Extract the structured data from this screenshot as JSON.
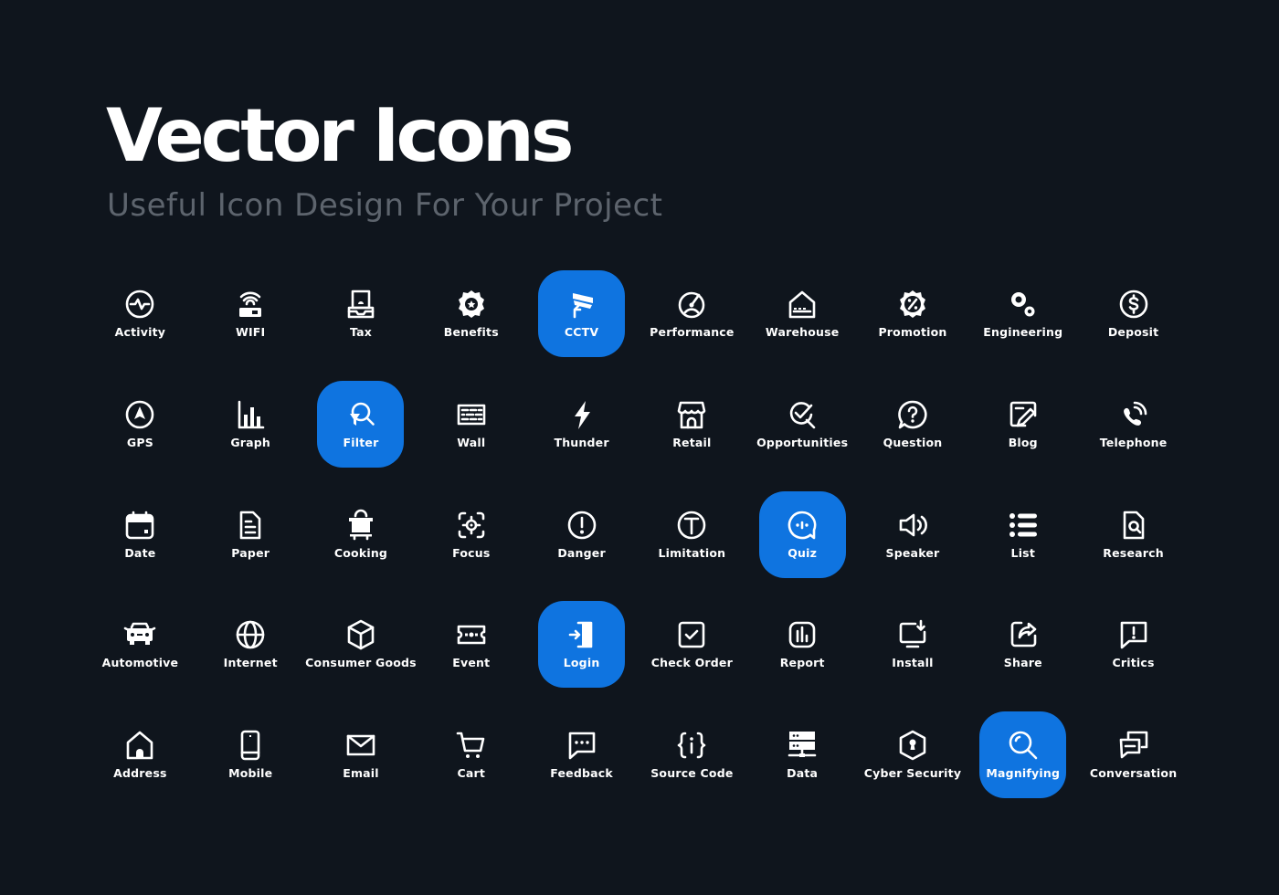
{
  "header": {
    "title": "Vector Icons",
    "subtitle": "Useful Icon Design For Your Project"
  },
  "colors": {
    "background": "#0f151d",
    "accent": "#0f74e0",
    "title": "#ffffff",
    "subtitle": "#5d646d",
    "icon": "#ffffff"
  },
  "icons": [
    {
      "label": "Activity",
      "icon": "activity-icon",
      "selected": false
    },
    {
      "label": "WIFI",
      "icon": "wifi-router-icon",
      "selected": false
    },
    {
      "label": "Tax",
      "icon": "tax-icon",
      "selected": false
    },
    {
      "label": "Benefits",
      "icon": "benefits-badge-icon",
      "selected": false
    },
    {
      "label": "CCTV",
      "icon": "cctv-camera-icon",
      "selected": true
    },
    {
      "label": "Performance",
      "icon": "performance-gauge-icon",
      "selected": false
    },
    {
      "label": "Warehouse",
      "icon": "warehouse-icon",
      "selected": false
    },
    {
      "label": "Promotion",
      "icon": "promotion-percent-badge-icon",
      "selected": false
    },
    {
      "label": "Engineering",
      "icon": "engineering-gears-icon",
      "selected": false
    },
    {
      "label": "Deposit",
      "icon": "deposit-dollar-icon",
      "selected": false
    },
    {
      "label": "GPS",
      "icon": "gps-navigation-icon",
      "selected": false
    },
    {
      "label": "Graph",
      "icon": "bar-graph-icon",
      "selected": false
    },
    {
      "label": "Filter",
      "icon": "filter-search-icon",
      "selected": true
    },
    {
      "label": "Wall",
      "icon": "brick-wall-icon",
      "selected": false
    },
    {
      "label": "Thunder",
      "icon": "thunder-bolt-icon",
      "selected": false
    },
    {
      "label": "Retail",
      "icon": "retail-store-icon",
      "selected": false
    },
    {
      "label": "Opportunities",
      "icon": "opportunities-search-check-icon",
      "selected": false
    },
    {
      "label": "Question",
      "icon": "question-bubble-icon",
      "selected": false
    },
    {
      "label": "Blog",
      "icon": "blog-edit-icon",
      "selected": false
    },
    {
      "label": "Telephone",
      "icon": "telephone-ringing-icon",
      "selected": false
    },
    {
      "label": "Date",
      "icon": "calendar-icon",
      "selected": false
    },
    {
      "label": "Paper",
      "icon": "paper-document-icon",
      "selected": false
    },
    {
      "label": "Cooking",
      "icon": "cooking-pot-icon",
      "selected": false
    },
    {
      "label": "Focus",
      "icon": "focus-target-icon",
      "selected": false
    },
    {
      "label": "Danger",
      "icon": "danger-exclamation-icon",
      "selected": false
    },
    {
      "label": "Limitation",
      "icon": "limitation-icon",
      "selected": false
    },
    {
      "label": "Quiz",
      "icon": "quiz-chat-icon",
      "selected": true
    },
    {
      "label": "Speaker",
      "icon": "speaker-icon",
      "selected": false
    },
    {
      "label": "List",
      "icon": "list-icon",
      "selected": false
    },
    {
      "label": "Research",
      "icon": "research-document-icon",
      "selected": false
    },
    {
      "label": "Automotive",
      "icon": "car-icon",
      "selected": false
    },
    {
      "label": "Internet",
      "icon": "globe-icon",
      "selected": false
    },
    {
      "label": "Consumer Goods",
      "icon": "box-cube-icon",
      "selected": false
    },
    {
      "label": "Event",
      "icon": "ticket-icon",
      "selected": false
    },
    {
      "label": "Login",
      "icon": "login-door-icon",
      "selected": true
    },
    {
      "label": "Check Order",
      "icon": "checkbox-icon",
      "selected": false
    },
    {
      "label": "Report",
      "icon": "report-chart-icon",
      "selected": false
    },
    {
      "label": "Install",
      "icon": "install-monitor-icon",
      "selected": false
    },
    {
      "label": "Share",
      "icon": "share-icon",
      "selected": false
    },
    {
      "label": "Critics",
      "icon": "critics-bubble-icon",
      "selected": false
    },
    {
      "label": "Address",
      "icon": "home-address-icon",
      "selected": false
    },
    {
      "label": "Mobile",
      "icon": "mobile-phone-icon",
      "selected": false
    },
    {
      "label": "Email",
      "icon": "email-envelope-icon",
      "selected": false
    },
    {
      "label": "Cart",
      "icon": "shopping-cart-icon",
      "selected": false
    },
    {
      "label": "Feedback",
      "icon": "feedback-bubble-icon",
      "selected": false
    },
    {
      "label": "Source Code",
      "icon": "source-code-icon",
      "selected": false
    },
    {
      "label": "Data",
      "icon": "data-server-icon",
      "selected": false
    },
    {
      "label": "Cyber Security",
      "icon": "cyber-security-shield-icon",
      "selected": false
    },
    {
      "label": "Magnifying",
      "icon": "magnifying-glass-icon",
      "selected": true
    },
    {
      "label": "Conversation",
      "icon": "conversation-bubbles-icon",
      "selected": false
    }
  ]
}
